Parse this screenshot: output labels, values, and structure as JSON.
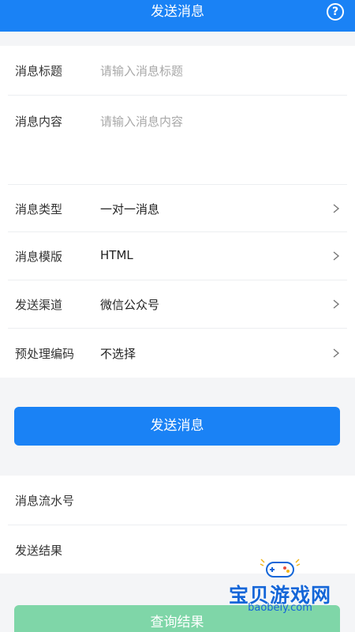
{
  "header": {
    "title": "发送消息",
    "help_icon": "question-circle-icon"
  },
  "form": {
    "title_label": "消息标题",
    "title_placeholder": "请输入消息标题",
    "content_label": "消息内容",
    "content_placeholder": "请输入消息内容",
    "type_label": "消息类型",
    "type_value": "一对一消息",
    "template_label": "消息模版",
    "template_value": "HTML",
    "channel_label": "发送渠道",
    "channel_value": "微信公众号",
    "precode_label": "预处理编码",
    "precode_value": "不选择"
  },
  "actions": {
    "send_label": "发送消息",
    "query_label": "查询结果"
  },
  "result": {
    "serial_label": "消息流水号",
    "result_label": "发送结果"
  },
  "watermark": {
    "text": "宝贝游戏网",
    "url": "baobeiy.com"
  },
  "colors": {
    "primary": "#1a82f5",
    "query_button": "#7fd6a8"
  }
}
